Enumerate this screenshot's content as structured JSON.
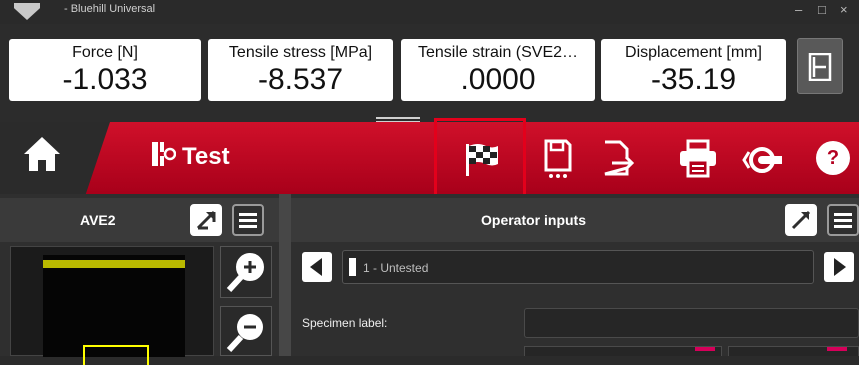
{
  "window": {
    "title": "- Bluehill Universal",
    "minimize": "–",
    "maximize": "□",
    "close": "×"
  },
  "readings": [
    {
      "label": "Force [N]",
      "value": "-1.033"
    },
    {
      "label": "Tensile stress [MPa]",
      "value": "-8.537"
    },
    {
      "label": "Tensile strain (SVE2…",
      "value": ".0000"
    },
    {
      "label": "Displacement [mm]",
      "value": "-35.19"
    }
  ],
  "ribbon": {
    "title": "Test",
    "help": "?"
  },
  "left_panel": {
    "title": "AVE2"
  },
  "right_panel": {
    "title": "Operator inputs",
    "specimen_nav": "1 - Untested",
    "specimen_label": "Specimen label:"
  },
  "colors": {
    "accent": "#c8102e",
    "highlight": "#e3001b",
    "camera_band": "#b9b900",
    "roi_box": "#ffff00"
  }
}
